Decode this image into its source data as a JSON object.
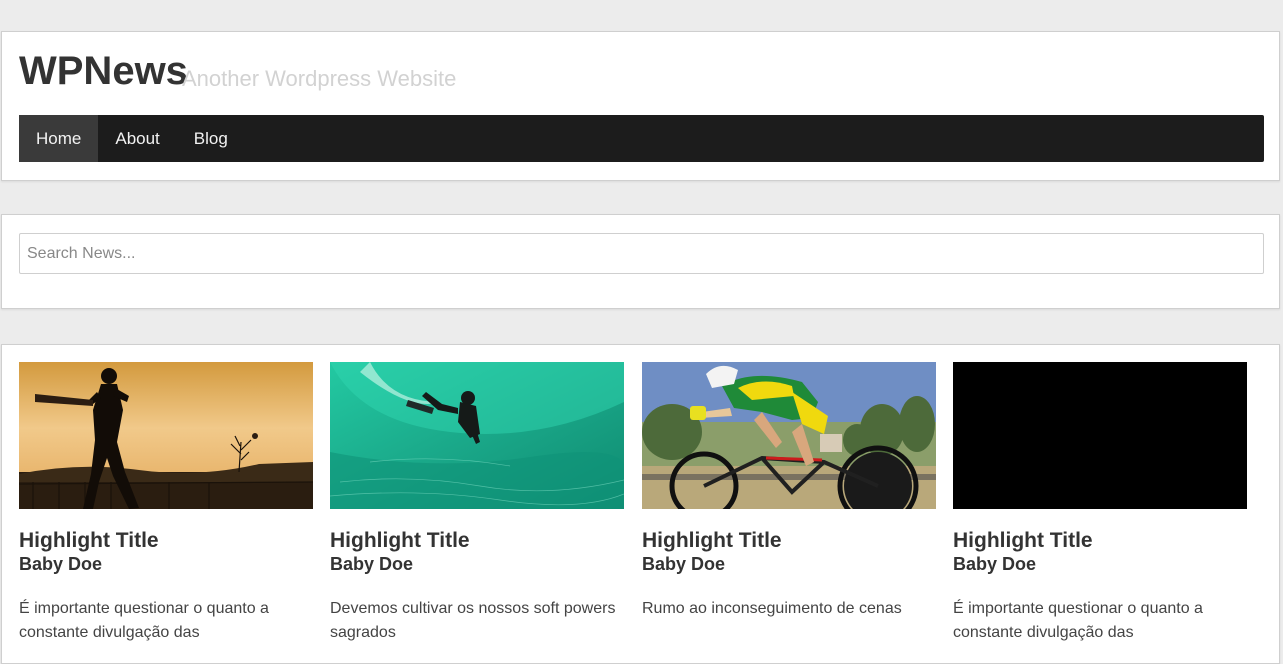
{
  "site": {
    "title": "WPNews",
    "tagline": "Another Wordpress Website"
  },
  "nav": {
    "items": [
      {
        "label": "Home",
        "active": true
      },
      {
        "label": "About",
        "active": false
      },
      {
        "label": "Blog",
        "active": false
      }
    ]
  },
  "search": {
    "placeholder": "Search News...",
    "value": ""
  },
  "highlights": [
    {
      "image": "cricket-batsman-silhouette-photo",
      "title": "Highlight Title",
      "author": "Baby Doe",
      "excerpt": "É importante questionar o quanto a constante divulgação das"
    },
    {
      "image": "bodyboarder-green-wave-photo",
      "title": "Highlight Title",
      "author": "Baby Doe",
      "excerpt": "Devemos cultivar os nossos soft powers sagrados"
    },
    {
      "image": "time-trial-cyclist-photo",
      "title": "Highlight Title",
      "author": "Baby Doe",
      "excerpt": "Rumo ao inconseguimento de cenas"
    },
    {
      "image": "black-placeholder-image",
      "title": "Highlight Title",
      "author": "Baby Doe",
      "excerpt": "É importante questionar o quanto a constante divulgação das"
    }
  ]
}
